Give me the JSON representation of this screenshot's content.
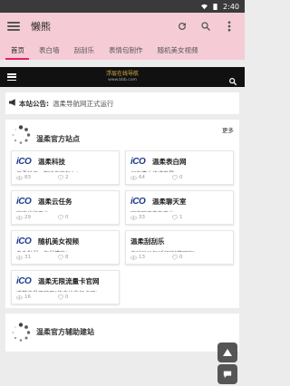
{
  "status": {
    "time": "2:40"
  },
  "appbar": {
    "title": "懒熊"
  },
  "tabs": [
    "首页",
    "表白墙",
    "刮刮乐",
    "表情包制作",
    "随机美女视频"
  ],
  "topnav": {
    "logo_text": "浮层在线导航",
    "logo_sub": "www.bbb.com"
  },
  "announcement": {
    "label": "本站公告:",
    "text": "温柔导航网正式运行"
  },
  "section1": {
    "title": "温柔官方站点",
    "more": "更多",
    "cards": [
      {
        "icon": "iCO",
        "name": "温柔科技",
        "desc": "温柔科技，期待你的加入!",
        "views": "83",
        "likes": "2"
      },
      {
        "icon": "iCO",
        "name": "温柔表白网",
        "desc": "祝有情人终成眷属",
        "views": "64",
        "likes": "0"
      },
      {
        "icon": "iCO",
        "name": "温柔云任务",
        "desc": "官方代挂平台",
        "views": "29",
        "likes": "0"
      },
      {
        "icon": "iCO",
        "name": "温柔聊天室",
        "desc": "官方聊天交友平台",
        "views": "33",
        "likes": "1"
      },
      {
        "icon": "iCO",
        "name": "随机美女视频",
        "desc": "老色批们，你们懂的!",
        "views": "31",
        "likes": "8"
      },
      {
        "icon": "",
        "name": "温柔刮刮乐",
        "desc": "来碰碰运气?刮到就带回家!",
        "views": "13",
        "likes": "0"
      },
      {
        "icon": "iCO",
        "name": "温柔无限流量卡官网",
        "desc": "感觉流量不够用?快来找我领卡吧!",
        "views": "16",
        "likes": "0"
      }
    ]
  },
  "section2": {
    "title": "温柔官方辅助建站"
  }
}
